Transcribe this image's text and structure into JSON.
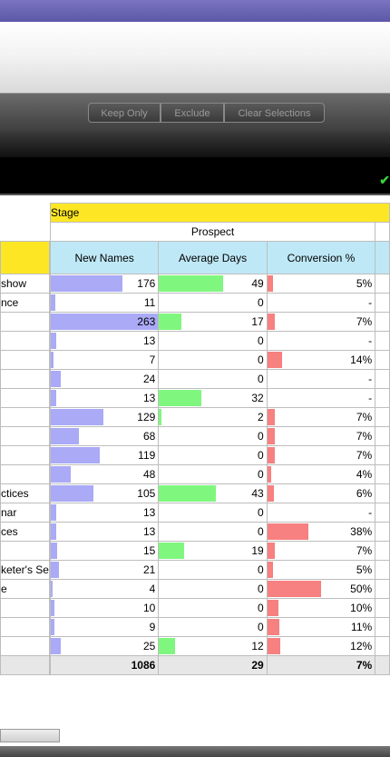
{
  "toolbar": {
    "keep_only": "Keep Only",
    "exclude": "Exclude",
    "clear_selections": "Clear Selections"
  },
  "table": {
    "stage_label": "Stage",
    "group_label": "Prospect",
    "columns": [
      "New Names",
      "Average Days",
      "Conversion %"
    ],
    "rows": [
      {
        "label": "show",
        "new": 176,
        "days": 49,
        "conv": "5%",
        "conv_pct": 5
      },
      {
        "label": "nce",
        "new": 11,
        "days": 0,
        "conv": "-",
        "conv_pct": 0
      },
      {
        "label": "",
        "new": 263,
        "days": 17,
        "conv": "7%",
        "conv_pct": 7
      },
      {
        "label": "",
        "new": 13,
        "days": 0,
        "conv": "-",
        "conv_pct": 0
      },
      {
        "label": "",
        "new": 7,
        "days": 0,
        "conv": "14%",
        "conv_pct": 14
      },
      {
        "label": "",
        "new": 24,
        "days": 0,
        "conv": "-",
        "conv_pct": 0
      },
      {
        "label": "",
        "new": 13,
        "days": 32,
        "conv": "-",
        "conv_pct": 0
      },
      {
        "label": "",
        "new": 129,
        "days": 2,
        "conv": "7%",
        "conv_pct": 7
      },
      {
        "label": "",
        "new": 68,
        "days": 0,
        "conv": "7%",
        "conv_pct": 7
      },
      {
        "label": "",
        "new": 119,
        "days": 0,
        "conv": "7%",
        "conv_pct": 7
      },
      {
        "label": "",
        "new": 48,
        "days": 0,
        "conv": "4%",
        "conv_pct": 4
      },
      {
        "label": "ctices",
        "new": 105,
        "days": 43,
        "conv": "6%",
        "conv_pct": 6
      },
      {
        "label": "nar",
        "new": 13,
        "days": 0,
        "conv": "-",
        "conv_pct": 0
      },
      {
        "label": "ces",
        "new": 13,
        "days": 0,
        "conv": "38%",
        "conv_pct": 38
      },
      {
        "label": "",
        "new": 15,
        "days": 19,
        "conv": "7%",
        "conv_pct": 7
      },
      {
        "label": "keter's Se",
        "new": 21,
        "days": 0,
        "conv": "5%",
        "conv_pct": 5
      },
      {
        "label": "e",
        "new": 4,
        "days": 0,
        "conv": "50%",
        "conv_pct": 50
      },
      {
        "label": "",
        "new": 10,
        "days": 0,
        "conv": "10%",
        "conv_pct": 10
      },
      {
        "label": "",
        "new": 9,
        "days": 0,
        "conv": "11%",
        "conv_pct": 11
      },
      {
        "label": "",
        "new": 25,
        "days": 12,
        "conv": "12%",
        "conv_pct": 12
      }
    ],
    "totals": {
      "new": "1086",
      "days": "29",
      "conv": "7%"
    }
  },
  "colors": {
    "new_bar": "#aaaaf7",
    "days_bar": "#7ff77f",
    "conv_bar": "#f78080",
    "stage_header": "#fde725",
    "column_header": "#bfe8f6"
  },
  "icons": {
    "status": "checkmark-icon"
  }
}
